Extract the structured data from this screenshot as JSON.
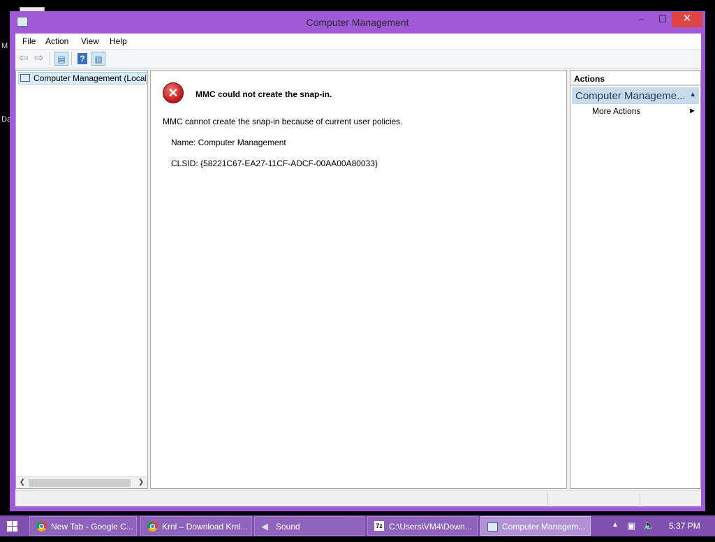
{
  "window": {
    "title": "Computer Management",
    "controls": {
      "minimize": "–",
      "maximize": "☐",
      "close": "✕"
    }
  },
  "menubar": {
    "items": [
      "File",
      "Action",
      "View",
      "Help"
    ]
  },
  "tree": {
    "root_label": "Computer Management (Local"
  },
  "error": {
    "title": "MMC could not create the snap-in.",
    "message": "MMC cannot create the snap-in because of current user policies.",
    "name_line": "Name: Computer Management",
    "clsid_line": "CLSID: {58221C67-EA27-11CF-ADCF-00AA00A80033}"
  },
  "actions": {
    "header": "Actions",
    "section": "Computer Manageme...",
    "items": [
      "More Actions"
    ]
  },
  "taskbar": {
    "buttons": [
      {
        "label": "New Tab - Google C...",
        "icon": "chrome-icon"
      },
      {
        "label": "Krnl – Download Krnl...",
        "icon": "chrome-icon"
      },
      {
        "label": "Sound",
        "icon": "speaker-icon"
      },
      {
        "label": "C:\\Users\\VM4\\Down...",
        "icon": "7zip-icon"
      },
      {
        "label": "Computer Managem...",
        "icon": "mmc-icon"
      }
    ],
    "clock": "5:37 PM"
  },
  "colors": {
    "window_frame": "#a05ad8",
    "taskbar": "#7f50b0",
    "close_button": "#e04343",
    "actions_section": "#c7dceb",
    "error_icon": "#c41f1f"
  }
}
